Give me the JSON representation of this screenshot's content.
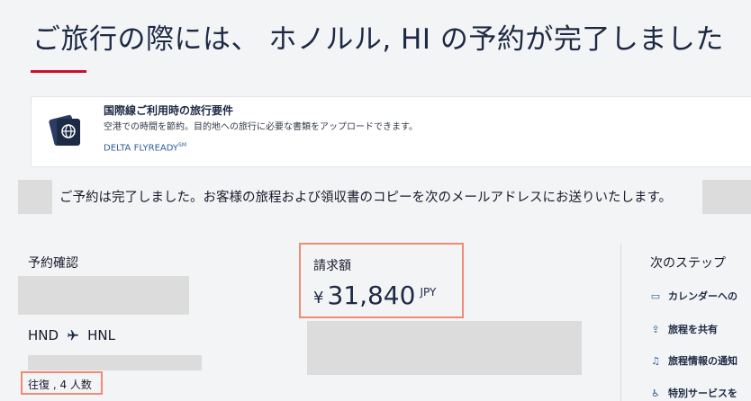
{
  "page": {
    "title": "ご旅行の際には、 ホノルル, HI の予約が完了しました",
    "accent_color": "#c8102e",
    "highlight_color": "#f08a74"
  },
  "flyready": {
    "title": "国際線ご利用時の旅行要件",
    "description": "空港での時間を節約。目的地への旅行に必要な書類をアップロードできます。",
    "link_label": "DELTA FLYREADY",
    "link_mark": "SM",
    "icon": "passport-icon"
  },
  "confirmation": {
    "message": "ご予約は完了しました。お客様の旅程および領収書のコピーを次のメールアドレスにお送りいたします。"
  },
  "booking": {
    "label": "予約確認",
    "origin": "HND",
    "destination": "HNL",
    "route_icon": "airplane-icon",
    "trip_info": "往復 , 4 人数"
  },
  "payment": {
    "label": "請求額",
    "currency_symbol": "¥",
    "amount": "31,840",
    "currency": "JPY"
  },
  "next_steps": {
    "label": "次のステップ",
    "items": [
      {
        "icon": "calendar-icon",
        "label": "カレンダーへの"
      },
      {
        "icon": "share-icon",
        "label": "旅程を共有"
      },
      {
        "icon": "bell-icon",
        "label": "旅程情報の通知"
      },
      {
        "icon": "accessibility-icon",
        "label": "特別サービスを"
      }
    ]
  }
}
